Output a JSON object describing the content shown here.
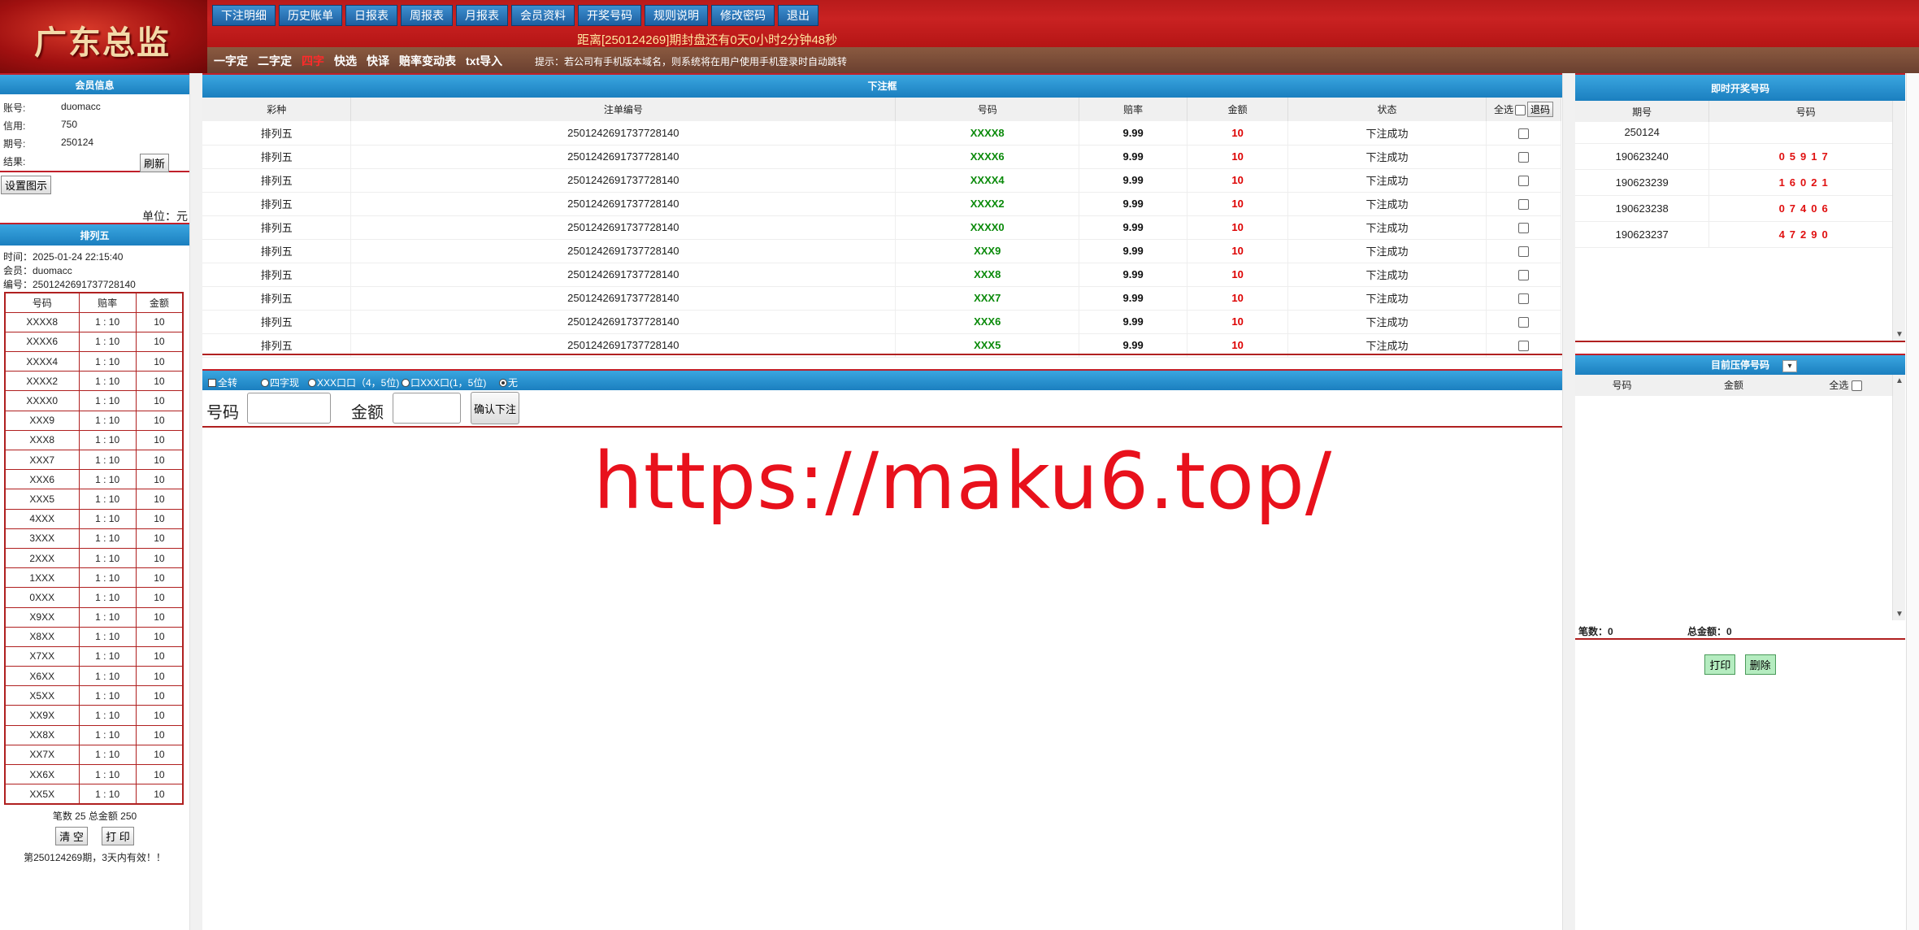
{
  "header": {
    "logo": "广东总监",
    "nav": [
      "下注明细",
      "历史账单",
      "日报表",
      "周报表",
      "月报表",
      "会员资料",
      "开奖号码",
      "规则说明",
      "修改密码",
      "退出"
    ],
    "countdown": "距离[250124269]期封盘还有0天0小时2分钟48秒",
    "subnav": [
      "一字定",
      "二字定",
      "四字",
      "快选",
      "快译",
      "赔率变动表",
      "txt导入"
    ],
    "tip": "提示：若公司有手机版本域名，则系统将在用户使用手机登录时自动跳转"
  },
  "member": {
    "title": "会员信息",
    "account_label": "账号:",
    "account": "duomacc",
    "credit_label": "信用:",
    "credit": "750",
    "period_label": "期号:",
    "period": "250124",
    "result_label": "结果:",
    "refresh": "刷新",
    "settings": "设置图示",
    "unit": "单位：元"
  },
  "ticket": {
    "title": "排列五",
    "time": "时间：2025-01-24 22:15:40",
    "member": "会员：duomacc",
    "serial": "编号：2501242691737728140",
    "headers": [
      "号码",
      "赔率",
      "金额"
    ],
    "rows": [
      [
        "XXXX8",
        "1 : 10",
        "10"
      ],
      [
        "XXXX6",
        "1 : 10",
        "10"
      ],
      [
        "XXXX4",
        "1 : 10",
        "10"
      ],
      [
        "XXXX2",
        "1 : 10",
        "10"
      ],
      [
        "XXXX0",
        "1 : 10",
        "10"
      ],
      [
        "XXX9",
        "1 : 10",
        "10"
      ],
      [
        "XXX8",
        "1 : 10",
        "10"
      ],
      [
        "XXX7",
        "1 : 10",
        "10"
      ],
      [
        "XXX6",
        "1 : 10",
        "10"
      ],
      [
        "XXX5",
        "1 : 10",
        "10"
      ],
      [
        "4XXX",
        "1 : 10",
        "10"
      ],
      [
        "3XXX",
        "1 : 10",
        "10"
      ],
      [
        "2XXX",
        "1 : 10",
        "10"
      ],
      [
        "1XXX",
        "1 : 10",
        "10"
      ],
      [
        "0XXX",
        "1 : 10",
        "10"
      ],
      [
        "X9XX",
        "1 : 10",
        "10"
      ],
      [
        "X8XX",
        "1 : 10",
        "10"
      ],
      [
        "X7XX",
        "1 : 10",
        "10"
      ],
      [
        "X6XX",
        "1 : 10",
        "10"
      ],
      [
        "X5XX",
        "1 : 10",
        "10"
      ],
      [
        "XX9X",
        "1 : 10",
        "10"
      ],
      [
        "XX8X",
        "1 : 10",
        "10"
      ],
      [
        "XX7X",
        "1 : 10",
        "10"
      ],
      [
        "XX6X",
        "1 : 10",
        "10"
      ],
      [
        "XX5X",
        "1 : 10",
        "10"
      ]
    ],
    "summary": "笔数 25 总金额 250",
    "clear": "清 空",
    "print": "打 印",
    "note": "第250124269期，3天内有效！！"
  },
  "orders": {
    "title": "下注框",
    "headers": [
      "彩种",
      "注单编号",
      "号码",
      "赔率",
      "金额",
      "状态",
      "全选"
    ],
    "refund": "退码",
    "rows": [
      {
        "game": "排列五",
        "id": "2501242691737728140",
        "num": "XXXX8",
        "odds": "9.99",
        "amt": "10",
        "status": "下注成功"
      },
      {
        "game": "排列五",
        "id": "2501242691737728140",
        "num": "XXXX6",
        "odds": "9.99",
        "amt": "10",
        "status": "下注成功"
      },
      {
        "game": "排列五",
        "id": "2501242691737728140",
        "num": "XXXX4",
        "odds": "9.99",
        "amt": "10",
        "status": "下注成功"
      },
      {
        "game": "排列五",
        "id": "2501242691737728140",
        "num": "XXXX2",
        "odds": "9.99",
        "amt": "10",
        "status": "下注成功"
      },
      {
        "game": "排列五",
        "id": "2501242691737728140",
        "num": "XXXX0",
        "odds": "9.99",
        "amt": "10",
        "status": "下注成功"
      },
      {
        "game": "排列五",
        "id": "2501242691737728140",
        "num": "XXX9",
        "odds": "9.99",
        "amt": "10",
        "status": "下注成功"
      },
      {
        "game": "排列五",
        "id": "2501242691737728140",
        "num": "XXX8",
        "odds": "9.99",
        "amt": "10",
        "status": "下注成功"
      },
      {
        "game": "排列五",
        "id": "2501242691737728140",
        "num": "XXX7",
        "odds": "9.99",
        "amt": "10",
        "status": "下注成功"
      },
      {
        "game": "排列五",
        "id": "2501242691737728140",
        "num": "XXX6",
        "odds": "9.99",
        "amt": "10",
        "status": "下注成功"
      },
      {
        "game": "排列五",
        "id": "2501242691737728140",
        "num": "XXX5",
        "odds": "9.99",
        "amt": "10",
        "status": "下注成功"
      }
    ]
  },
  "betbar": {
    "transfer": "全转",
    "options": [
      "四字现",
      "XXX口口（4，5位)",
      "口XXX口(1，5位)",
      "无"
    ],
    "selected": 3
  },
  "betform": {
    "num_label": "号码",
    "amt_label": "金额",
    "confirm": "确认下注"
  },
  "watermark": "https://maku6.top/",
  "draws": {
    "title": "即时开奖号码",
    "headers": [
      "期号",
      "号码"
    ],
    "current": "250124",
    "rows": [
      {
        "period": "190623240",
        "num": "05917"
      },
      {
        "period": "190623239",
        "num": "16021"
      },
      {
        "period": "190623238",
        "num": "07406"
      },
      {
        "period": "190623237",
        "num": "47290"
      }
    ]
  },
  "limit": {
    "title": "目前压停号码",
    "headers": [
      "号码",
      "金额",
      "全选"
    ],
    "count_label": "笔数：",
    "count": "0",
    "total_label": "总金额：",
    "total": "0",
    "print": "打印",
    "delete": "删除"
  },
  "colors": {
    "accent_blue": "#1b7fbf",
    "header_red": "#b81b1b",
    "win_red": "#e01010",
    "num_green": "#0a8a0a"
  }
}
